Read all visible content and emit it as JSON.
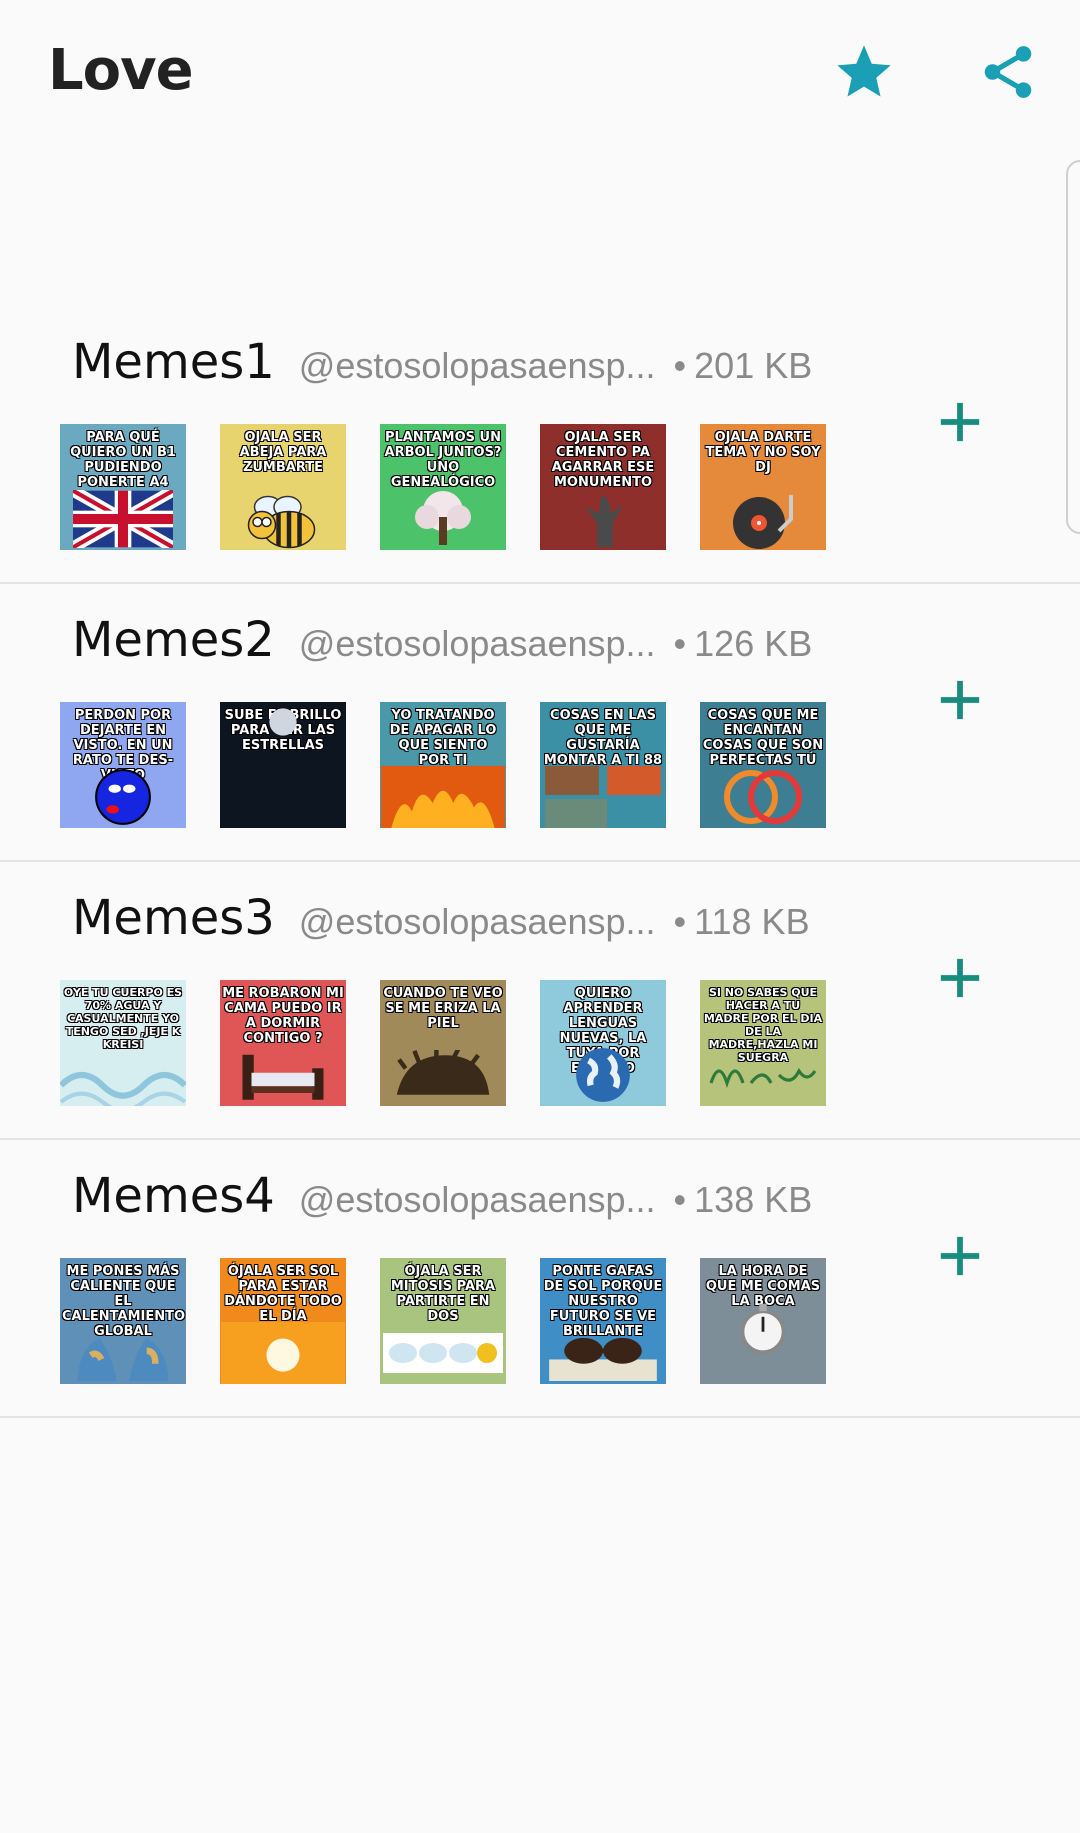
{
  "app": {
    "title": "Love",
    "accent_color": "#1a9fb5",
    "add_color": "#198c80",
    "icons": {
      "favorite": "star-icon",
      "share": "share-icon",
      "add": "plus-icon"
    }
  },
  "packs": [
    {
      "name": "Memes1",
      "publisher": "@estosolopasaensp...",
      "dot": "•",
      "size": "201 KB",
      "stickers": [
        {
          "text": "PARA QUÉ QUIERO UN B1 PUDIENDO PONERTE A4",
          "bg": "#6aa9c0"
        },
        {
          "text": "OJALA SER ABEJA PARA ZUMBARTE",
          "bg": "#e7d46e"
        },
        {
          "text": "PLANTAMOS UN ARBOL JUNTOS? UNO GENEALÓGICO",
          "bg": "#4cc36a"
        },
        {
          "text": "OJALA SER CEMENTO PA AGARRAR ESE MONUMENTO",
          "bg": "#8e2f2b"
        },
        {
          "text": "OJALA DARTE TEMA Y NO SOY DJ",
          "bg": "#e48a3a"
        }
      ]
    },
    {
      "name": "Memes2",
      "publisher": "@estosolopasaensp...",
      "dot": "•",
      "size": "126 KB",
      "stickers": [
        {
          "text": "PERDON POR DEJARTE EN VISTO. EN UN RATO TE DES-VISTO",
          "bg": "#8fa6f0"
        },
        {
          "text": "SUBE EL BRILLO PARA VER LAS ESTRELLAS",
          "bg": "#0d1520"
        },
        {
          "text": "YO TRATANDO DE APAGAR LO QUE SIENTO POR TI",
          "bg": "#4a98a8"
        },
        {
          "text": "COSAS EN LAS QUE ME GUSTARÍA MONTAR A TI 88",
          "bg": "#3c90a6"
        },
        {
          "text": "COSAS QUE ME ENCANTAN COSAS QUE SON PERFECTAS TÚ",
          "bg": "#3e7e92"
        }
      ]
    },
    {
      "name": "Memes3",
      "publisher": "@estosolopasaensp...",
      "dot": "•",
      "size": "118 KB",
      "stickers": [
        {
          "text": "OYE TU CUERPO ES 70% AGUA Y CASUALMENTE YO TENGO SED ,JEJE K KREISI",
          "bg": "#d6eef0"
        },
        {
          "text": "ME ROBARON MI CAMA PUEDO IR A DORMIR CONTIGO ?",
          "bg": "#e05555"
        },
        {
          "text": "CUANDO TE VEO SE ME ERIZA LA PIEL",
          "bg": "#a08a5a"
        },
        {
          "text": "QUIERO APRENDER LENGUAS NUEVAS, LA TUYA POR EJEMPLO",
          "bg": "#8ecadc"
        },
        {
          "text": "SI NO SABES QUE HACER A TU MADRE POR EL DIA DE LA MADRE,HAZLA MI SUEGRA",
          "bg": "#b5c47a"
        }
      ]
    },
    {
      "name": "Memes4",
      "publisher": "@estosolopasaensp...",
      "dot": "•",
      "size": "138 KB",
      "stickers": [
        {
          "text": "ME PONES MÁS CALIENTE QUE EL CALENTAMIENTO GLOBAL",
          "bg": "#5e90b8"
        },
        {
          "text": "ÓJALA SER SOL PARA ESTAR DÁNDOTE TODO EL DÍA",
          "bg": "#f08a1c"
        },
        {
          "text": "ÓJALA SER MITOSIS PARA PARTIRTE EN DOS",
          "bg": "#a9c47e"
        },
        {
          "text": "PONTE GAFAS DE SOL PORQUE NUESTRO FUTURO SE VE BRILLANTE",
          "bg": "#3f8fc6"
        },
        {
          "text": "LA HORA DE QUE ME COMAS LA BOCA",
          "bg": "#7e8e98"
        }
      ]
    }
  ]
}
